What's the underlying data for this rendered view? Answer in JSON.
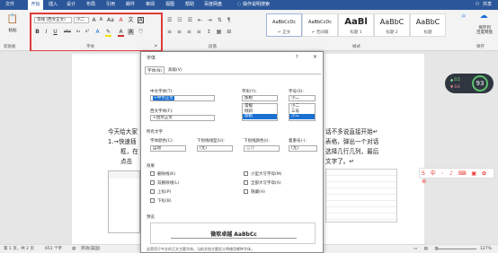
{
  "tabs": [
    "文件",
    "开始",
    "插入",
    "设计",
    "布局",
    "引用",
    "邮件",
    "审阅",
    "视图",
    "帮助",
    "百度网盘"
  ],
  "tab_active": 1,
  "tell_me": "操作说明搜索",
  "user": "共享",
  "ribbon": {
    "clipboard_label": "剪贴板",
    "paste_label": "粘贴",
    "font_label": "字体",
    "paragraph_label": "段落",
    "styles_label": "样式",
    "save_label": "保存",
    "font_name": "等线 (西文正文)",
    "font_size": "小二",
    "font_buttons": [
      "B",
      "I",
      "U",
      "abc",
      "x₂",
      "x²",
      "A",
      "A",
      "A"
    ],
    "grow": "A",
    "shrink": "A",
    "styles": [
      {
        "preview": "AaBbCcDc",
        "name": "↵ 正文"
      },
      {
        "preview": "AaBbCcDc",
        "name": "↵ 无间隔"
      },
      {
        "preview": "AaBl",
        "name": "标题 1"
      },
      {
        "preview": "AaBbC",
        "name": "标题 2"
      },
      {
        "preview": "AaBbC",
        "name": "标题"
      }
    ],
    "baidu": [
      "保存到",
      "百度网盘"
    ]
  },
  "document": {
    "line1_left": "今天给大家",
    "line1_right": "话不多说直接开始↵",
    "line2_left": "1.→快速插",
    "line2_right": "表格，弹出一个对话",
    "line3_left": "框，在",
    "line3_right": "选择几行几列，最后",
    "line4_left": "点击",
    "line4_right": "文字了。↵"
  },
  "dialog": {
    "title": "字体",
    "help": "?",
    "close": "×",
    "tabs": [
      "字体(N)",
      "高级(V)"
    ],
    "cn_font_label": "中文字体(T):",
    "cn_font_value": "+中文正文",
    "style_label": "字形(Y):",
    "style_value": "加粗",
    "style_list": [
      "常规",
      "倾斜",
      "加粗"
    ],
    "size_label": "字号(S):",
    "size_value": "小二",
    "size_list": [
      "小二",
      "三号",
      "小三"
    ],
    "west_font_label": "西文字体(F):",
    "west_font_value": "+西文正文",
    "all_text_label": "所有文字",
    "color_label": "字体颜色(C):",
    "color_value": "自动",
    "underline_label": "下划线线型(U):",
    "underline_value": "(无)",
    "underline_color_label": "下划线颜色(I):",
    "underline_color_value": "自动",
    "emphasis_label": "着重号(·):",
    "emphasis_value": "(无)",
    "effects_label": "效果",
    "effects": [
      "删除线(K)",
      "双删除线(L)",
      "上标(P)",
      "下标(B)"
    ],
    "effects_right": [
      "小型大写字母(M)",
      "全部大写字母(A)",
      "隐藏(H)"
    ],
    "preview_label": "预览",
    "preview_text": "微软卓越  AaBbCc",
    "note": "这是用于中文的正文主题字体。当前文档主题定义将使用哪种字体。"
  },
  "status": {
    "page": "第 1 页，共 2 页",
    "words": "651 个字",
    "lang": "英语(美国)",
    "zoom": "127%"
  },
  "badge": {
    "value": "93",
    "unit": "%",
    "up": "0.5",
    "down": "0.6"
  }
}
